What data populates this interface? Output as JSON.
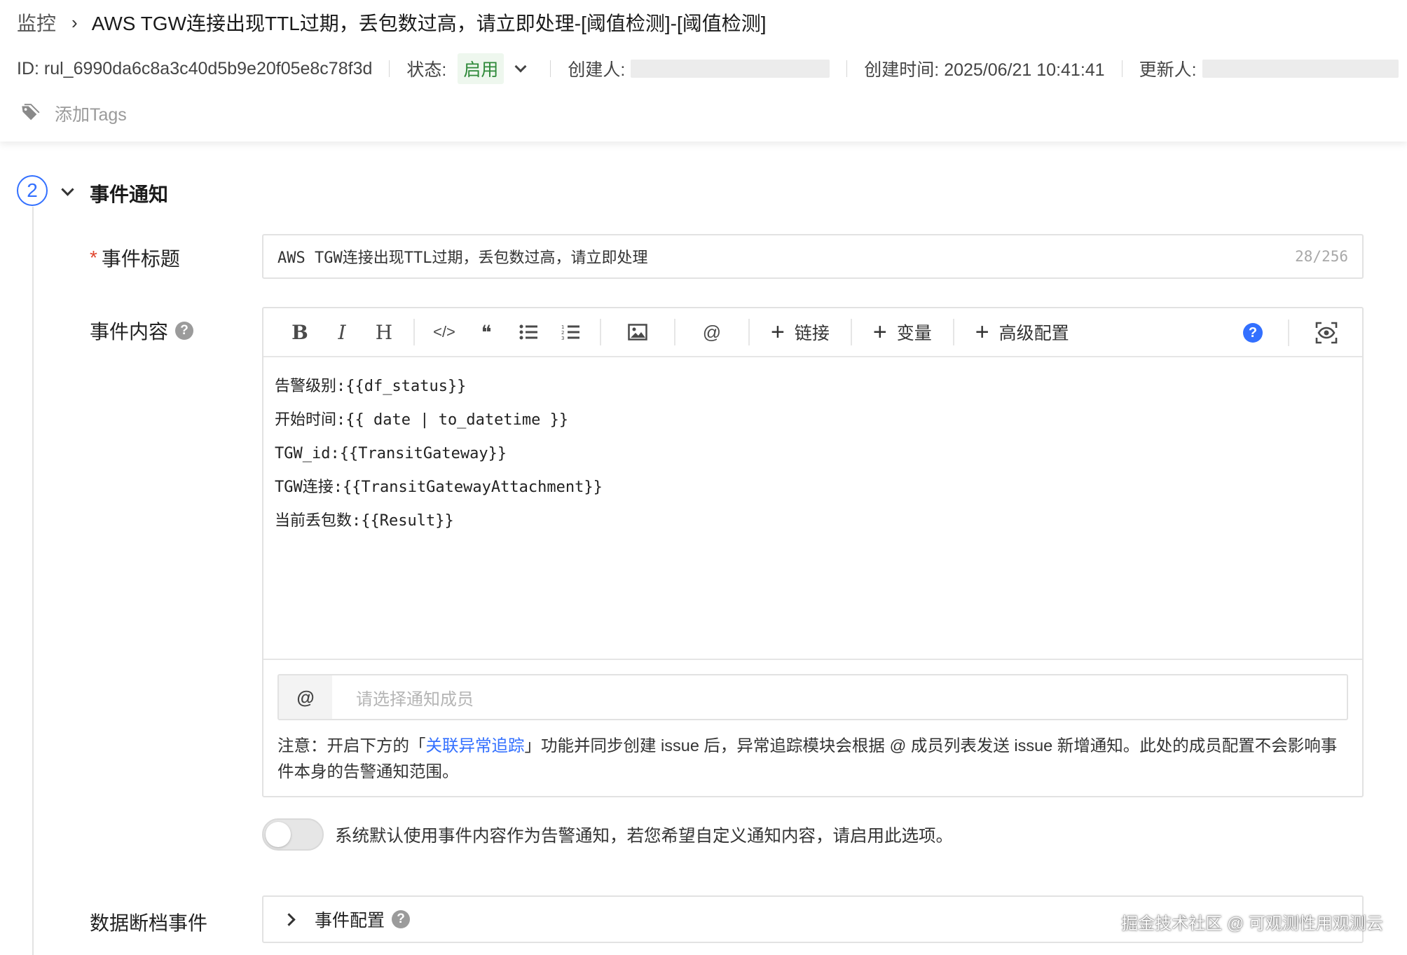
{
  "breadcrumb": {
    "root": "监控",
    "title": "AWS TGW连接出现TTL过期，丢包数过高，请立即处理-[阈值检测]-[阈值检测]"
  },
  "meta": {
    "id": "ID: rul_6990da6c8a3c40d5b9e20f05e8c78f3d",
    "status_label": "状态:",
    "status_value": "启用",
    "creator_label": "创建人:",
    "created_time": "创建时间: 2025/06/21 10:41:41",
    "updater_label": "更新人:"
  },
  "tags": {
    "placeholder": "添加Tags"
  },
  "section": {
    "step": "2",
    "title": "事件通知"
  },
  "event_title": {
    "label": "事件标题",
    "required_mark": "*",
    "value": "AWS TGW连接出现TTL过期，丢包数过高，请立即处理",
    "count": "28/256"
  },
  "event_content": {
    "label": "事件内容",
    "help": "?",
    "toolbar": {
      "bold": "B",
      "italic": "I",
      "heading": "H",
      "code": "</>",
      "quote": "❝",
      "mention": "@",
      "link": "链接",
      "variable": "变量",
      "advanced": "高级配置",
      "help": "?"
    },
    "lines": [
      "告警级别:{{df_status}}",
      "开始时间:{{ date | to_datetime }}",
      "TGW_id:{{TransitGateway}}",
      "TGW连接:{{TransitGatewayAttachment}}",
      "当前丢包数:{{Result}}"
    ],
    "mention_prefix": "@",
    "mention_placeholder": "请选择通知成员",
    "note_before": "注意：开启下方的「",
    "note_link": "关联异常追踪",
    "note_after": "」功能并同步创建 issue 后，异常追踪模块会根据 @ 成员列表发送 issue 新增通知。此处的成员配置不会影响事件本身的告警通知范围。"
  },
  "custom_notify": {
    "enabled": false,
    "label": "系统默认使用事件内容作为告警通知，若您希望自定义通知内容，请启用此选项。"
  },
  "data_gap": {
    "label": "数据断档事件",
    "config_label": "事件配置",
    "help": "?"
  },
  "watermark": "掘金技术社区 @ 可观测性用观测云",
  "colors": {
    "accent": "#3370ff",
    "status_green": "#2f8a3a",
    "required_red": "#e0462f"
  }
}
